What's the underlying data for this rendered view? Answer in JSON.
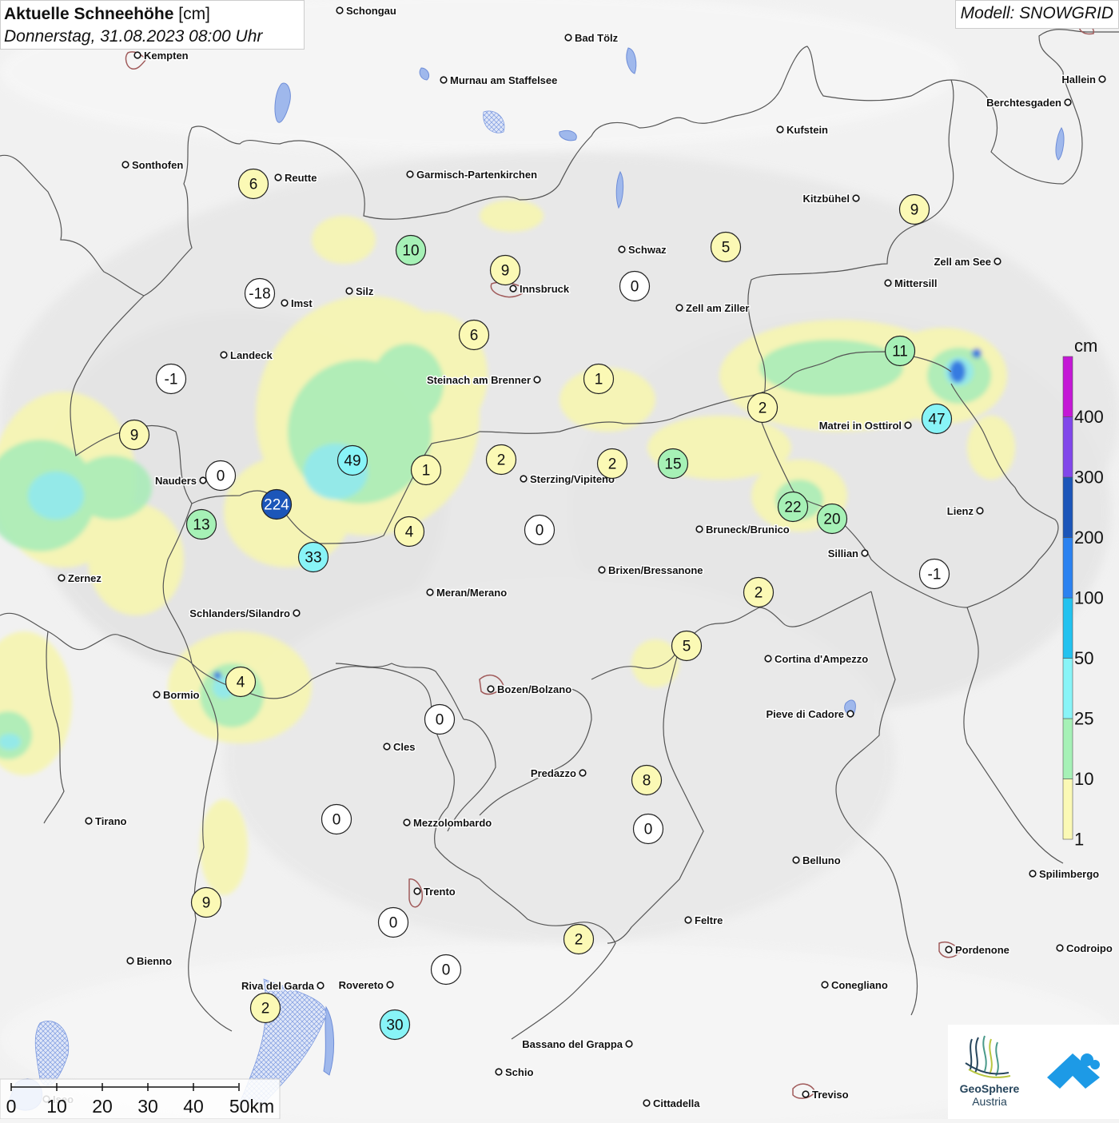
{
  "title": {
    "bold": "Aktuelle Schneehöhe",
    "unit": "[cm]",
    "subtitle": "Donnerstag, 31.08.2023 08:00 Uhr"
  },
  "model": "Modell: SNOWGRID",
  "legend": {
    "unit": "cm",
    "levels": [
      {
        "label": "1",
        "color": "#fbf9b5"
      },
      {
        "label": "10",
        "color": "#a6f1b6"
      },
      {
        "label": "25",
        "color": "#88f4f7"
      },
      {
        "label": "50",
        "color": "#22c2ef"
      },
      {
        "label": "100",
        "color": "#2b82f0"
      },
      {
        "label": "200",
        "color": "#1c56b9"
      },
      {
        "label": "300",
        "color": "#8147ea"
      },
      {
        "label": "400",
        "color": "#c418d6"
      }
    ]
  },
  "scalebar": {
    "labels": [
      "0",
      "10",
      "20",
      "30",
      "40",
      "50km"
    ]
  },
  "logo": {
    "name_bold": "GeoSphere",
    "name_light": "Austria"
  },
  "cities": [
    "Schongau",
    "Kempten",
    "Bad Tölz",
    "Murnau am Staffelsee",
    "Hallein",
    "Berchtesgaden",
    "Kufstein",
    "Sonthofen",
    "Reutte",
    "Garmisch-Partenkirchen",
    "Kitzbühel",
    "Schwaz",
    "Zell am See",
    "Innsbruck",
    "Silz",
    "Imst",
    "Mittersill",
    "Zell am Ziller",
    "Landeck",
    "Steinach am Brenner",
    "Matrei in Osttirol",
    "Nauders",
    "Sterzing/Vipiteno",
    "Lienz",
    "Bruneck/Brunico",
    "Sillian",
    "Zernez",
    "Brixen/Bressanone",
    "Meran/Merano",
    "Schlanders/Silandro",
    "Cortina d'Ampezzo",
    "Bozen/Bolzano",
    "Bormio",
    "Pieve di Cadore",
    "Cles",
    "Predazzo",
    "Tirano",
    "Mezzolombardo",
    "Belluno",
    "Spilimbergo",
    "Trento",
    "Feltre",
    "Pordenone",
    "Codroipo",
    "Bienno",
    "Riva del Garda",
    "Rovereto",
    "Conegliano",
    "Bassano del Grappa",
    "Schio",
    "Treviso",
    "Cittadella",
    "Iseo"
  ],
  "stations": [
    "6",
    "10",
    "9",
    "-18",
    "0",
    "5",
    "9",
    "6",
    "-1",
    "1",
    "11",
    "2",
    "47",
    "9",
    "0",
    "49",
    "1",
    "2",
    "2",
    "15",
    "224",
    "13",
    "4",
    "0",
    "22",
    "20",
    "33",
    "-1",
    "2",
    "5",
    "4",
    "0",
    "8",
    "0",
    "0",
    "9",
    "0",
    "0",
    "2",
    "2",
    "30"
  ]
}
